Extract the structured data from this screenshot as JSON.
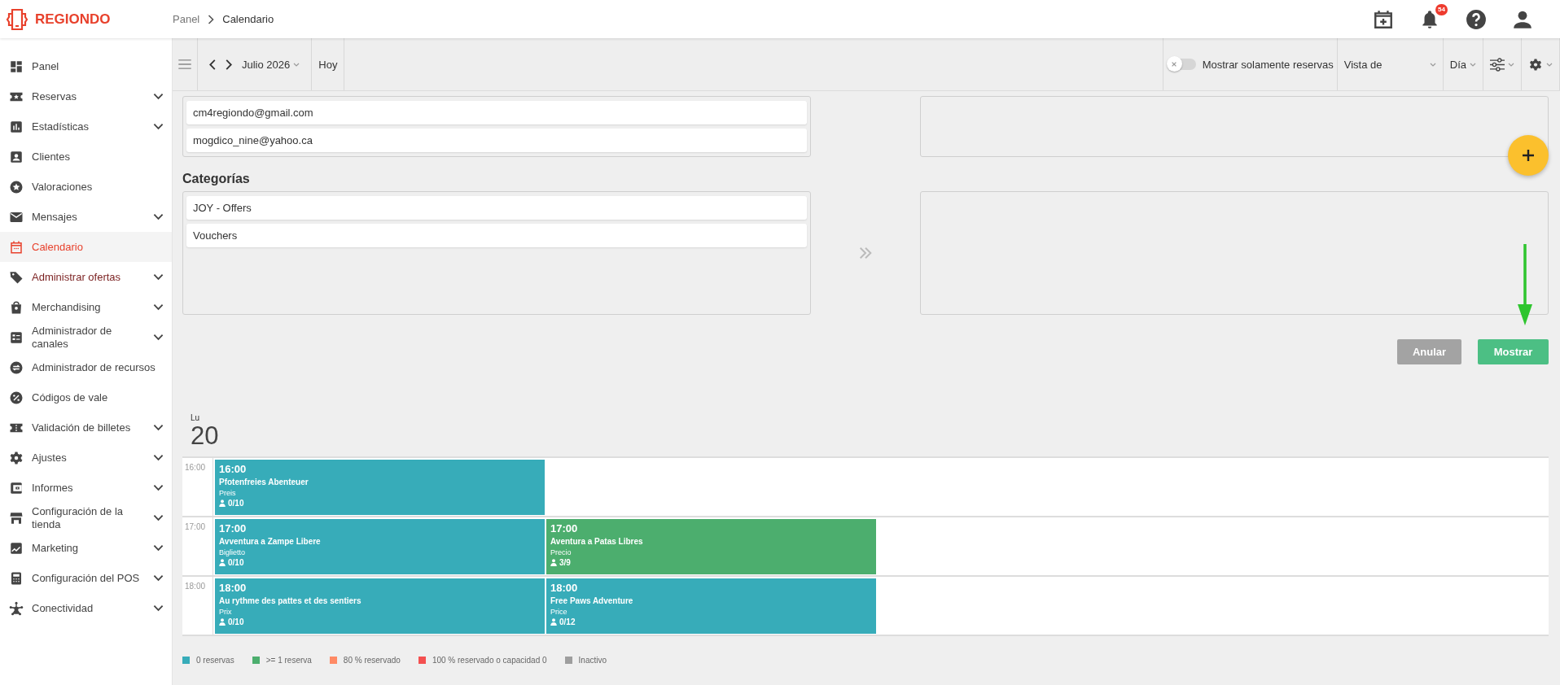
{
  "brand": {
    "name": "REGIONDO"
  },
  "breadcrumb": [
    "Panel",
    "Calendario"
  ],
  "header": {
    "notification_count": "54"
  },
  "sidebar": {
    "items": [
      {
        "label": "Panel",
        "expandable": false,
        "selected": false,
        "highlighted": false
      },
      {
        "label": "Reservas",
        "expandable": true,
        "selected": false,
        "highlighted": false
      },
      {
        "label": "Estadísticas",
        "expandable": true,
        "selected": false,
        "highlighted": false
      },
      {
        "label": "Clientes",
        "expandable": false,
        "selected": false,
        "highlighted": false
      },
      {
        "label": "Valoraciones",
        "expandable": false,
        "selected": false,
        "highlighted": false
      },
      {
        "label": "Mensajes",
        "expandable": true,
        "selected": false,
        "highlighted": false
      },
      {
        "label": "Calendario",
        "expandable": false,
        "selected": true,
        "highlighted": false
      },
      {
        "label": "Administrar ofertas",
        "expandable": true,
        "selected": false,
        "highlighted": true
      },
      {
        "label": "Merchandising",
        "expandable": true,
        "selected": false,
        "highlighted": false
      },
      {
        "label": "Administrador de canales",
        "expandable": true,
        "selected": false,
        "highlighted": false
      },
      {
        "label": "Administrador de recursos",
        "expandable": false,
        "selected": false,
        "highlighted": false
      },
      {
        "label": "Códigos de vale",
        "expandable": false,
        "selected": false,
        "highlighted": false
      },
      {
        "label": "Validación de billetes",
        "expandable": true,
        "selected": false,
        "highlighted": false
      },
      {
        "label": "Ajustes",
        "expandable": true,
        "selected": false,
        "highlighted": false
      },
      {
        "label": "Informes",
        "expandable": true,
        "selected": false,
        "highlighted": false
      },
      {
        "label": "Configuración de la tienda",
        "expandable": true,
        "selected": false,
        "highlighted": false
      },
      {
        "label": "Marketing",
        "expandable": true,
        "selected": false,
        "highlighted": false
      },
      {
        "label": "Configuración del POS",
        "expandable": true,
        "selected": false,
        "highlighted": false
      },
      {
        "label": "Conectividad",
        "expandable": true,
        "selected": false,
        "highlighted": false
      }
    ]
  },
  "toolbar": {
    "month": "Julio 2026",
    "today": "Hoy",
    "toggle": {
      "label": "Mostrar solamente reservas",
      "on": false
    },
    "view": "Vista de",
    "period": "Día"
  },
  "emails": [
    "cm4regiondo@gmail.com",
    "mogdico_nine@yahoo.ca"
  ],
  "categories": {
    "heading": "Categorías",
    "items": [
      "JOY - Offers",
      "Vouchers"
    ]
  },
  "buttons": {
    "cancel": "Anular",
    "show": "Mostrar"
  },
  "day": {
    "weekday": "Lu",
    "date": "20"
  },
  "calendar": {
    "rows": [
      {
        "time": "16:00",
        "events": [
          {
            "time": "16:00",
            "title": "Pfotenfreies Abenteuer",
            "price_label": "Preis",
            "capacity": "0/10",
            "color": "#37acb9"
          }
        ]
      },
      {
        "time": "17:00",
        "events": [
          {
            "time": "17:00",
            "title": "Avventura a Zampe Libere",
            "price_label": "Biglietto",
            "capacity": "0/10",
            "color": "#37acb9"
          },
          {
            "time": "17:00",
            "title": "Aventura a Patas Libres",
            "price_label": "Precio",
            "capacity": "3/9",
            "color": "#4cae6e"
          }
        ]
      },
      {
        "time": "18:00",
        "events": [
          {
            "time": "18:00",
            "title": "Au rythme des pattes et des sentiers",
            "price_label": "Prix",
            "capacity": "0/10",
            "color": "#37acb9"
          },
          {
            "time": "18:00",
            "title": "Free Paws Adventure",
            "price_label": "Price",
            "capacity": "0/12",
            "color": "#37acb9"
          }
        ]
      }
    ]
  },
  "legend": [
    {
      "label": "0 reservas",
      "color": "#37acb9"
    },
    {
      "label": ">= 1 reserva",
      "color": "#4cae6e"
    },
    {
      "label": "80 % reservado",
      "color": "#ff8a65"
    },
    {
      "label": "100 % reservado o capacidad 0",
      "color": "#f45050"
    },
    {
      "label": "Inactivo",
      "color": "#9e9e9e"
    }
  ]
}
